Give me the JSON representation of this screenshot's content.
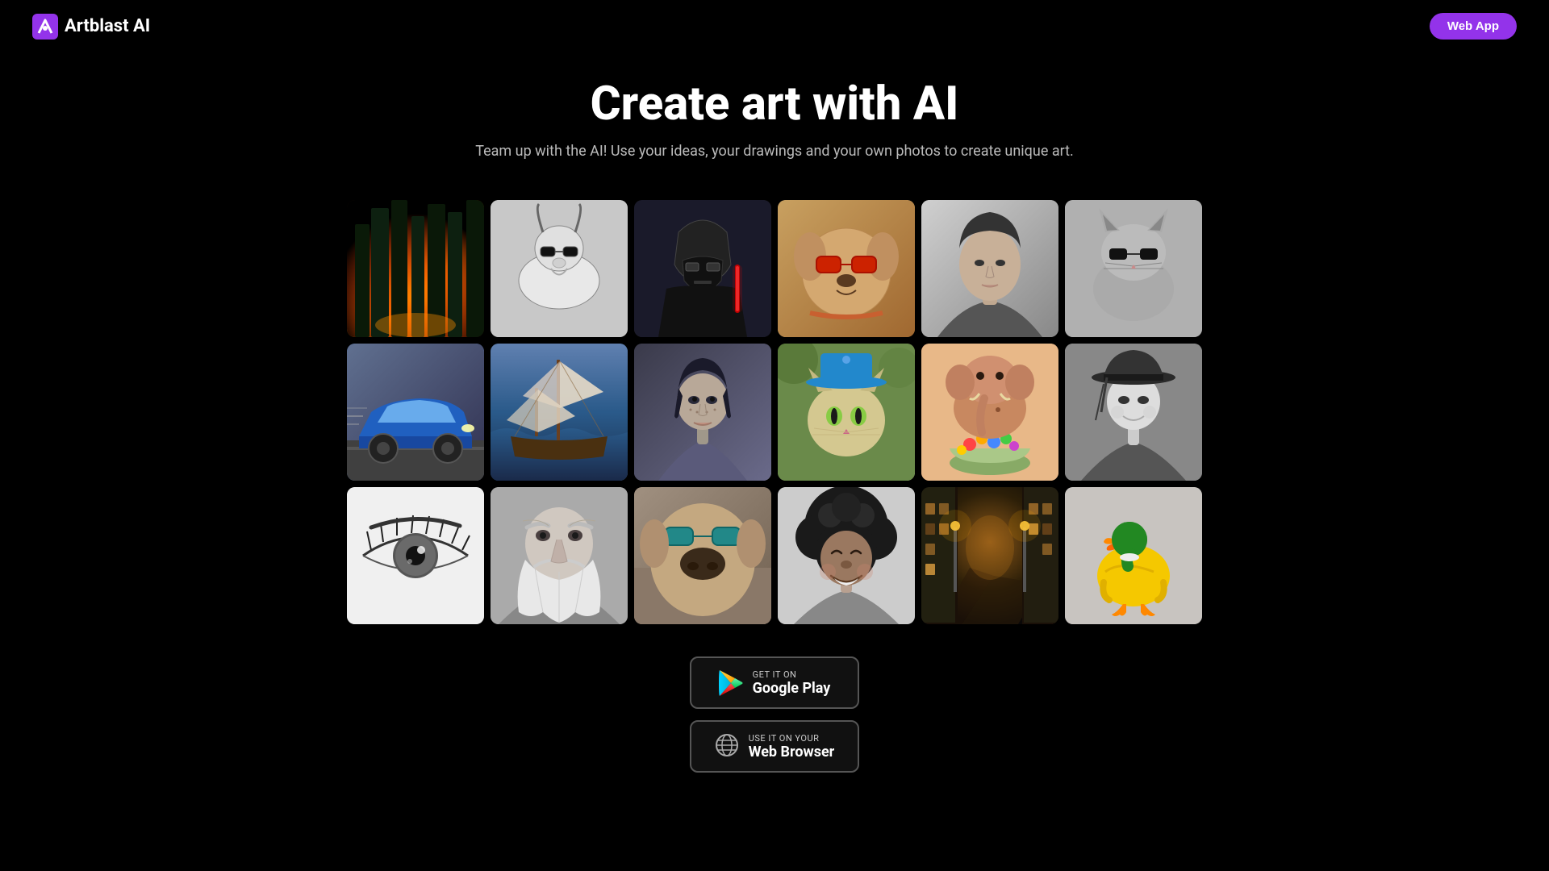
{
  "header": {
    "logo_text": "Artblast AI",
    "web_app_label": "Web App"
  },
  "hero": {
    "title": "Create art with AI",
    "subtitle": "Team up with the AI! Use your ideas, your drawings and your own photos to create unique art."
  },
  "gallery": {
    "cells": [
      {
        "id": "forest",
        "alt": "Forest with sunlight",
        "class": "cell-forest"
      },
      {
        "id": "goat",
        "alt": "Goat with sunglasses",
        "class": "cell-goat"
      },
      {
        "id": "darth",
        "alt": "Darth Vader figurine",
        "class": "cell-darth"
      },
      {
        "id": "dog-sunglasses",
        "alt": "Dog with red sunglasses",
        "class": "cell-dog-sunglasses"
      },
      {
        "id": "woman-bw",
        "alt": "Woman portrait black and white",
        "class": "cell-woman-bw"
      },
      {
        "id": "cat-bw",
        "alt": "Cat with sunglasses black and white",
        "class": "cell-cat-bw"
      },
      {
        "id": "car",
        "alt": "Blue sports car",
        "class": "cell-car"
      },
      {
        "id": "ship",
        "alt": "Sailing ship on ocean",
        "class": "cell-ship"
      },
      {
        "id": "girl-art",
        "alt": "Digital art portrait of girl",
        "class": "cell-girl-art"
      },
      {
        "id": "cat-hat",
        "alt": "Cat with blue hat",
        "class": "cell-cat-hat"
      },
      {
        "id": "elephant",
        "alt": "Elephant figurine with candy",
        "class": "cell-elephant"
      },
      {
        "id": "woman-hat",
        "alt": "Woman with hat black and white",
        "class": "cell-woman-hat"
      },
      {
        "id": "eye",
        "alt": "Close up eye sketch",
        "class": "cell-eye"
      },
      {
        "id": "wizard",
        "alt": "Wizard portrait",
        "class": "cell-wizard"
      },
      {
        "id": "dog-sunglasses2",
        "alt": "Dog with sunglasses outdoors",
        "class": "cell-dog-sunglasses2"
      },
      {
        "id": "woman-afro",
        "alt": "Woman with afro hair",
        "class": "cell-woman-afro"
      },
      {
        "id": "alley",
        "alt": "Night alley with lights",
        "class": "cell-alley"
      },
      {
        "id": "duck",
        "alt": "Colorful toy duck",
        "class": "cell-duck"
      }
    ]
  },
  "cta": {
    "google_play": {
      "small": "GET IT ON",
      "big": "Google Play",
      "icon": "google-play"
    },
    "web_browser": {
      "small": "Use it on your",
      "big": "Web Browser",
      "icon": "web"
    }
  }
}
